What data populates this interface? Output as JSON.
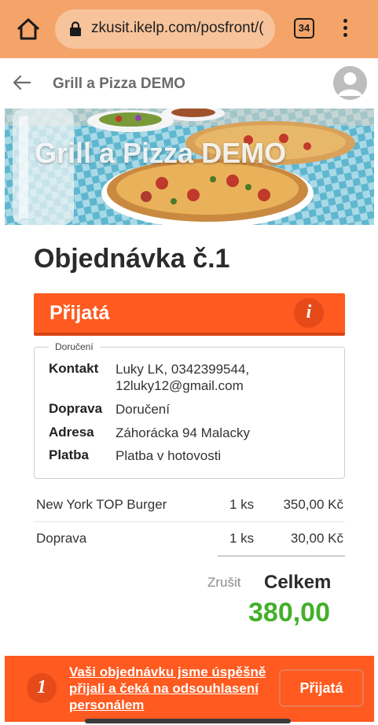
{
  "browser": {
    "url": "zkusit.ikelp.com/posfront/(",
    "tab_count": "34",
    "chrome_color": "#f4a468"
  },
  "appbar": {
    "title": "Grill a Pizza DEMO"
  },
  "hero": {
    "title": "Grill a Pizza DEMO"
  },
  "order": {
    "title": "Objednávka č.1",
    "status": "Přijatá",
    "status_color": "#ff5a1f"
  },
  "delivery": {
    "legend": "Doručení",
    "rows": [
      {
        "key": "Kontakt",
        "value": "Luky LK, 0342399544, 12luky12@gmail.com"
      },
      {
        "key": "Doprava",
        "value": "Doručení"
      },
      {
        "key": "Adresa",
        "value": "Záhorácka 94 Malacky"
      },
      {
        "key": "Platba",
        "value": "Platba v hotovosti"
      }
    ]
  },
  "items": [
    {
      "name": "New York TOP Burger",
      "qty": "1 ks",
      "price": "350,00 Kč"
    },
    {
      "name": "Doprava",
      "qty": "1 ks",
      "price": "30,00 Kč"
    }
  ],
  "summary": {
    "cancel_label": "Zrušit",
    "total_label": "Celkem",
    "total_value": "380,00",
    "total_color": "#43b02a"
  },
  "bottom": {
    "step": "1",
    "message": "Vaši objednávku jsme úspěšně přijali a čeká na odsouhlasení personálem",
    "button_label": "Přijatá"
  }
}
